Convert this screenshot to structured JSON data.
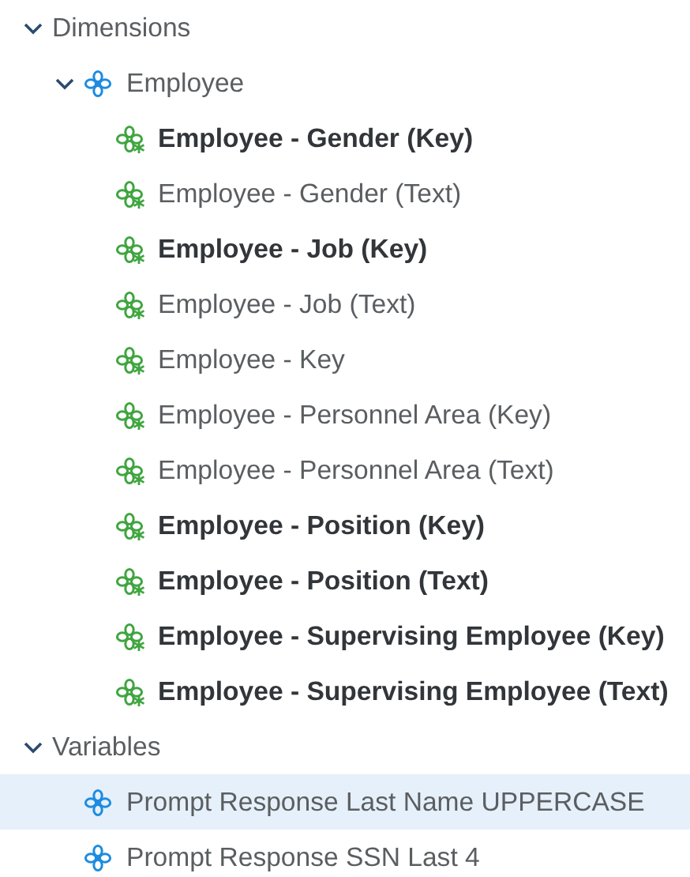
{
  "tree": [
    {
      "label": "Dimensions",
      "expanded": true,
      "selected": false,
      "emphasized": false,
      "children": [
        {
          "label": "Employee",
          "kind": "dimension",
          "expanded": true,
          "selected": false,
          "emphasized": false,
          "children": [
            {
              "label": "Employee - Gender (Key)",
              "kind": "attribute",
              "selected": false,
              "emphasized": true
            },
            {
              "label": "Employee - Gender (Text)",
              "kind": "attribute",
              "selected": false,
              "emphasized": false
            },
            {
              "label": "Employee - Job (Key)",
              "kind": "attribute",
              "selected": false,
              "emphasized": true
            },
            {
              "label": "Employee - Job (Text)",
              "kind": "attribute",
              "selected": false,
              "emphasized": false
            },
            {
              "label": "Employee - Key",
              "kind": "attribute",
              "selected": false,
              "emphasized": false
            },
            {
              "label": "Employee - Personnel Area (Key)",
              "kind": "attribute",
              "selected": false,
              "emphasized": false
            },
            {
              "label": "Employee - Personnel Area (Text)",
              "kind": "attribute",
              "selected": false,
              "emphasized": false
            },
            {
              "label": "Employee - Position (Key)",
              "kind": "attribute",
              "selected": false,
              "emphasized": true
            },
            {
              "label": "Employee - Position (Text)",
              "kind": "attribute",
              "selected": false,
              "emphasized": true
            },
            {
              "label": "Employee - Supervising Employee (Key)",
              "kind": "attribute",
              "selected": false,
              "emphasized": true
            },
            {
              "label": "Employee - Supervising Employee (Text)",
              "kind": "attribute",
              "selected": false,
              "emphasized": true
            }
          ]
        }
      ]
    },
    {
      "label": "Variables",
      "expanded": true,
      "selected": false,
      "emphasized": false,
      "children": [
        {
          "label": "Prompt Response Last Name UPPERCASE",
          "kind": "dimension",
          "selected": true,
          "emphasized": false
        },
        {
          "label": "Prompt Response SSN Last 4",
          "kind": "dimension",
          "selected": false,
          "emphasized": false
        }
      ]
    }
  ]
}
